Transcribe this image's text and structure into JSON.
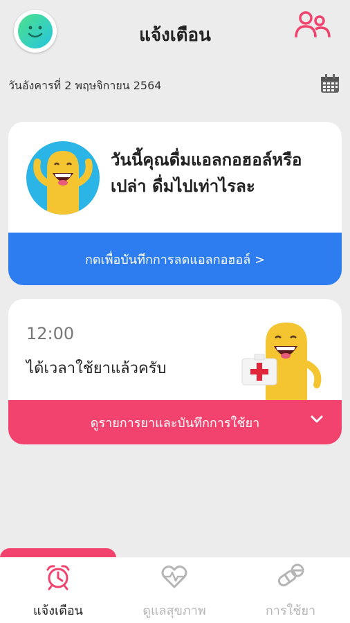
{
  "header": {
    "title": "แจ้งเตือน"
  },
  "date": "วันอังคารที่  2 พฤษจิกายน 2564",
  "alcohol_card": {
    "question": "วันนี้คุณดื่มแอลกอฮอล์หรือเปล่า ดื่มไปเท่าไรละ",
    "action": "กดเพื่อบันทึกการลดแอลกอฮอล์ >"
  },
  "medicine_card": {
    "time": "12:00",
    "message": "ได้เวลาใช้ยาแล้วครับ",
    "action": "ดูรายการยาและบันทึกการใช้ยา"
  },
  "tabs": [
    {
      "label": "แจ้งเตือน",
      "icon": "alarm-clock-icon",
      "active": true
    },
    {
      "label": "ดูแลสุขภาพ",
      "icon": "heart-pulse-icon",
      "active": false
    },
    {
      "label": "การใช้ยา",
      "icon": "pill-icon",
      "active": false
    }
  ],
  "colors": {
    "accent_pink": "#f2436e",
    "accent_blue": "#2d7cf0",
    "inactive": "#b5b5b5"
  }
}
